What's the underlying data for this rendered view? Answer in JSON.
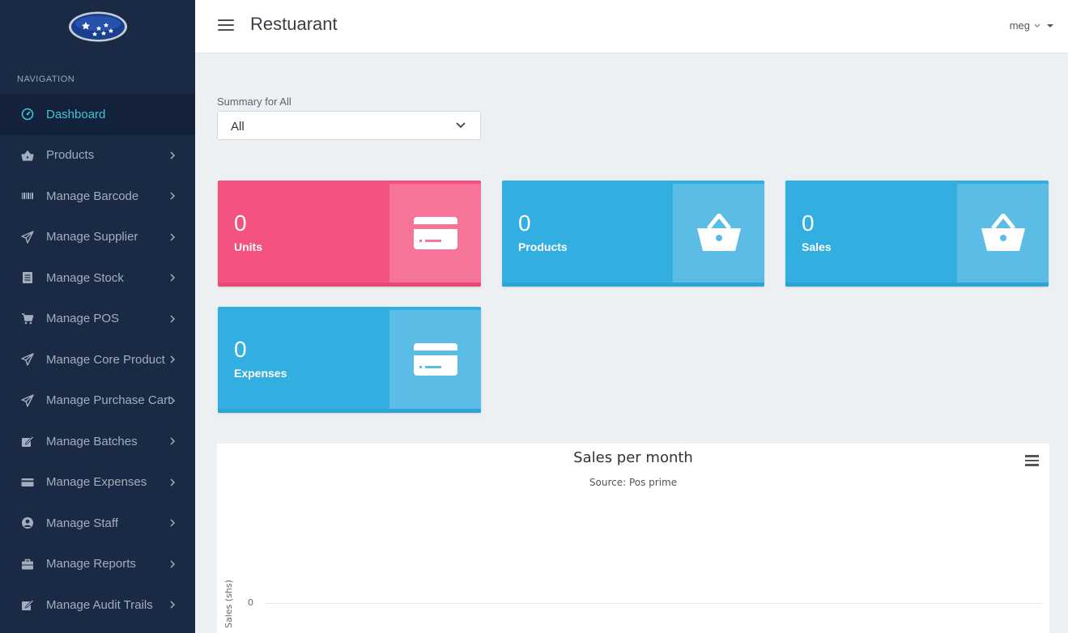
{
  "header": {
    "title": "Restuarant",
    "user": "meg"
  },
  "sidebar": {
    "nav_header": "NAVIGATION",
    "items": [
      {
        "label": "Dashboard",
        "icon": "dashboard-gauge-icon",
        "active": true
      },
      {
        "label": "Products",
        "icon": "basket-icon"
      },
      {
        "label": "Manage Barcode",
        "icon": "barcode-icon"
      },
      {
        "label": "Manage Supplier",
        "icon": "paper-plane-icon"
      },
      {
        "label": "Manage Stock",
        "icon": "list-icon"
      },
      {
        "label": "Manage POS",
        "icon": "cart-icon"
      },
      {
        "label": "Manage Core Product",
        "icon": "paper-plane-icon"
      },
      {
        "label": "Manage Purchase Cart",
        "icon": "paper-plane-icon"
      },
      {
        "label": "Manage Batches",
        "icon": "edit-icon"
      },
      {
        "label": "Manage Expenses",
        "icon": "credit-card-icon"
      },
      {
        "label": "Manage Staff",
        "icon": "user-circle-icon"
      },
      {
        "label": "Manage Reports",
        "icon": "briefcase-icon"
      },
      {
        "label": "Manage Audit Trails",
        "icon": "edit-icon"
      }
    ]
  },
  "summary": {
    "label": "Summary for All",
    "selected": "All"
  },
  "cards": [
    {
      "value": "0",
      "label": "Units",
      "color": "#f2527d",
      "icon": "credit-card-icon"
    },
    {
      "value": "0",
      "label": "Products",
      "color": "#33aee0",
      "icon": "basket-icon"
    },
    {
      "value": "0",
      "label": "Sales",
      "color": "#33aee0",
      "icon": "basket-icon"
    },
    {
      "value": "0",
      "label": "Expenses",
      "color": "#33aee0",
      "icon": "credit-card-icon"
    }
  ],
  "chart_data": {
    "type": "line",
    "title": "Sales per month",
    "subtitle": "Source: Pos prime",
    "ylabel": "Sales (shs)",
    "yticks": [
      "0"
    ],
    "series": []
  },
  "colors": {
    "sidebar_bg": "#1b2a44",
    "active_text": "#3fc5d9",
    "pink": "#f2527d",
    "blue": "#33aee0"
  }
}
